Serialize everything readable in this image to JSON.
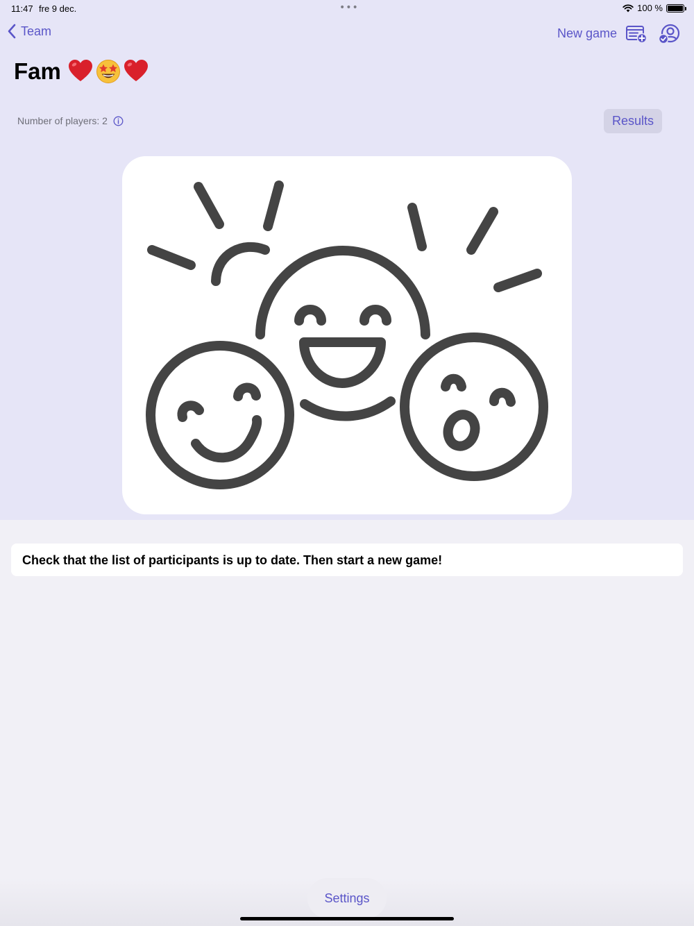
{
  "status_bar": {
    "time": "11:47",
    "date": "fre 9 dec.",
    "multitask_dots": "•••",
    "battery_text": "100 %"
  },
  "nav": {
    "back_label": "Team",
    "new_game_label": "New game",
    "new_game_icon": "list-add-icon",
    "team_icon": "person-check-icon"
  },
  "title": {
    "text": "Fam",
    "emojis": [
      "❤️",
      "🤩",
      "❤️"
    ]
  },
  "players": {
    "label": "Number of players: 2",
    "info_icon": "info-circle-icon"
  },
  "results_button": "Results",
  "illustration": "smiling-faces-illustration",
  "info_message": "Check that the list of participants is up to date. Then start a new game!",
  "settings_button": "Settings",
  "colors": {
    "accent": "#5a55c8",
    "header_bg": "#e6e5f7",
    "page_bg": "#f1f0f6",
    "illustration_stroke": "#444444"
  }
}
